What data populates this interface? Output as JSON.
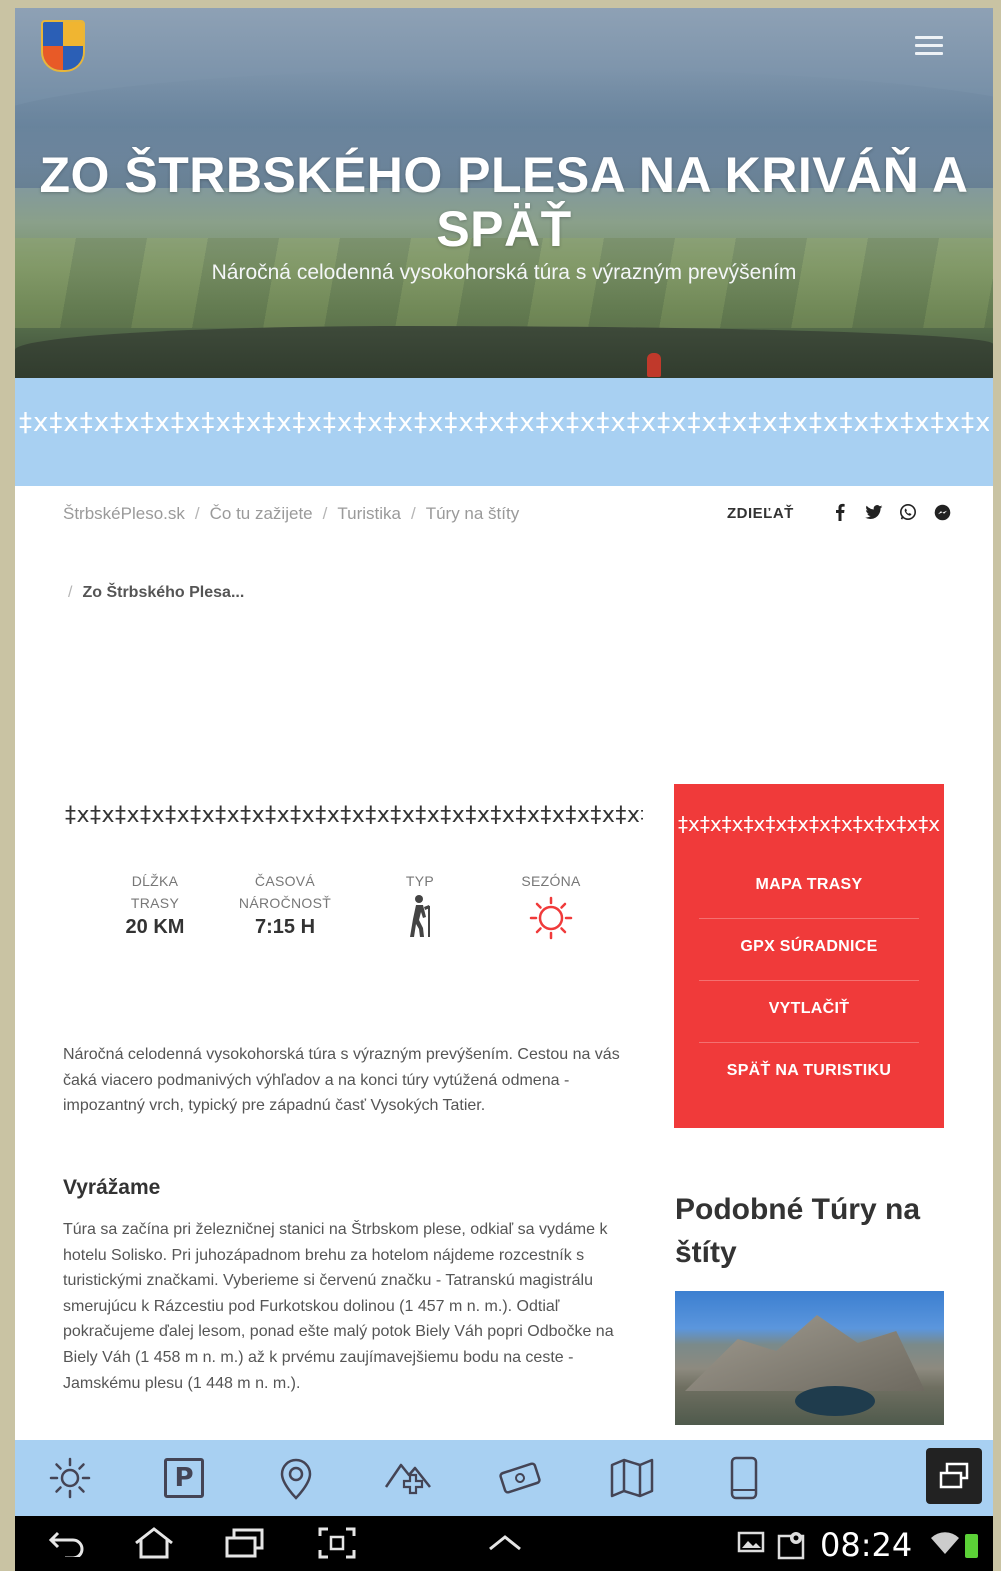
{
  "header": {
    "title": "ZO ŠTRBSKÉHO PLESA NA KRIVÁŇ A SPÄŤ",
    "subtitle": "Náročná celodenná vysokohorská túra s výrazným prevýšením"
  },
  "folk_pattern": "‡x‡x‡x‡x‡x‡x‡x‡x‡x‡x‡x‡x‡x‡x‡x‡x‡x‡x‡x‡x‡x‡x‡x‡x‡x‡x‡x‡x‡x‡x‡x‡x‡x‡x‡x‡x‡x‡",
  "breadcrumb": {
    "items": [
      "ŠtrbskéPleso.sk",
      "Čo tu zažijete",
      "Turistika",
      "Túry na štíty"
    ],
    "current": "Zo Štrbského Plesa..."
  },
  "share": {
    "label": "ZDIEĽAŤ",
    "icons": [
      "f",
      "t",
      "w",
      "m"
    ]
  },
  "stats": {
    "length_label": "DĹŽKA\nTRASY",
    "length_value": "20 KM",
    "time_label": "ČASOVÁ\nNÁROČNOSŤ",
    "time_value": "7:15 H",
    "type_label": "TYP",
    "season_label": "SEZÓNA"
  },
  "intro": "Náročná celodenná vysokohorská túra s výrazným prevýšením. Cestou na vás čaká viacero podmanivých výhľadov a na konci túry vytúžená odmena - impozantný vrch, typický pre západnú časť Vysokých Tatier.",
  "section": {
    "heading": "Vyrážame",
    "text": "Túra sa začína pri železničnej stanici na Štrbskom plese, odkiaľ sa vydáme k hotelu Solisko. Pri juhozápadnom brehu za hotelom nájdeme rozcestník s turistickými značkami. Vyberieme si červenú značku - Tatranskú magistrálu smerujúcu k Rázcestiu pod Furkotskou dolinou (1 457 m n. m.). Odtiaľ pokračujeme ďalej lesom, ponad ešte malý potok Biely Váh popri Odbočke na Biely Váh (1 458 m n. m.) až k prvému zaujímavejšiemu bodu na ceste - Jamskému plesu (1 448 m n. m.)."
  },
  "actions": [
    "MAPA TRASY",
    "GPX SÚRADNICE",
    "VYTLAČIŤ",
    "SPÄŤ NA TURISTIKU"
  ],
  "similar_title": "Podobné Túry na štíty",
  "system": {
    "time": "08:24"
  },
  "colors": {
    "band": "#a8d0f2",
    "accent_red": "#f03a3a"
  }
}
